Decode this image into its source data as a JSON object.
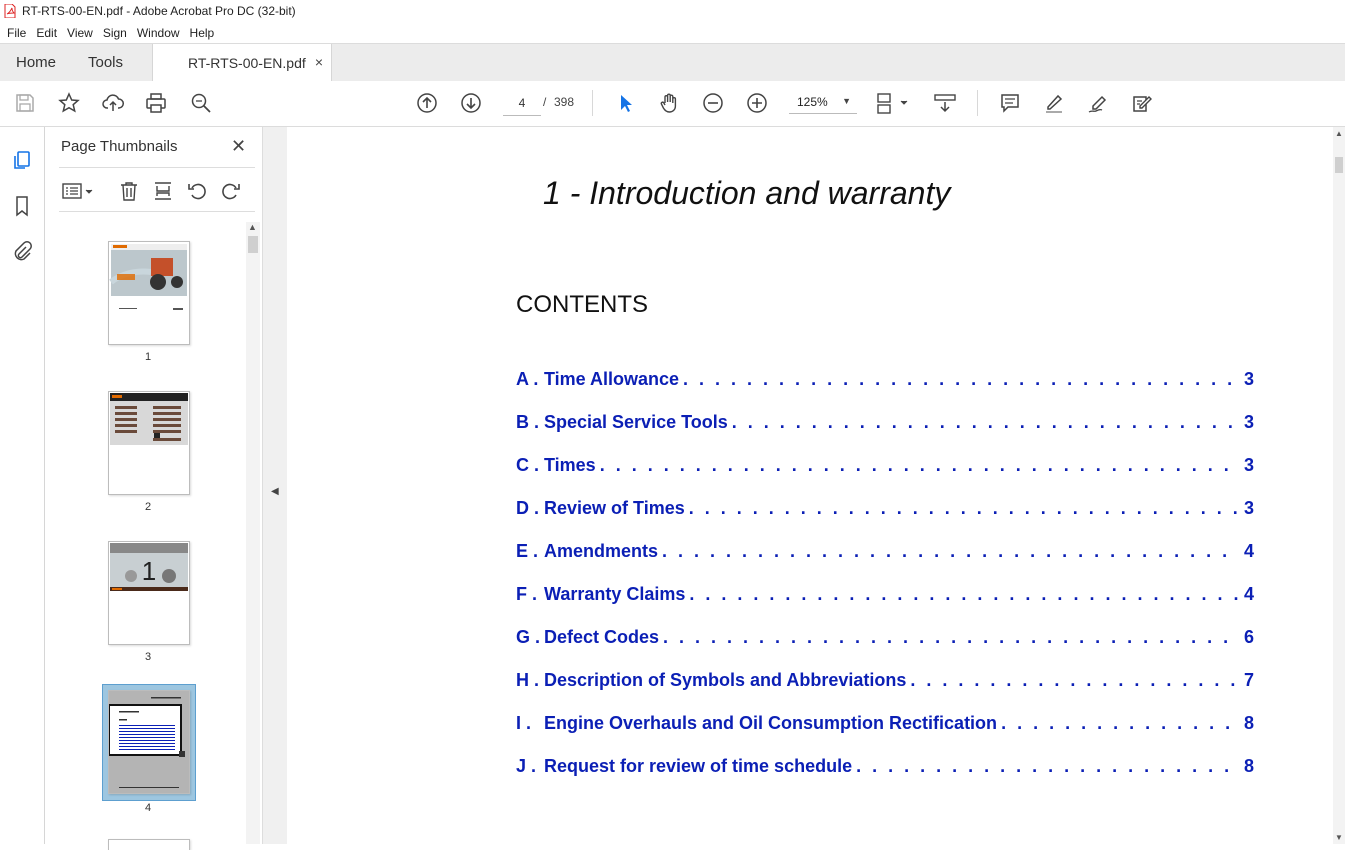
{
  "window": {
    "title": "RT-RTS-00-EN.pdf - Adobe Acrobat Pro DC (32-bit)"
  },
  "menu": [
    "File",
    "Edit",
    "View",
    "Sign",
    "Window",
    "Help"
  ],
  "tabs": {
    "home": "Home",
    "tools": "Tools",
    "document": "RT-RTS-00-EN.pdf",
    "close_glyph": "×"
  },
  "toolbar": {
    "current_page": "4",
    "page_separator": "/",
    "total_pages": "398",
    "zoom": "125%",
    "icons": [
      "save-icon",
      "bookmark-star-icon",
      "upload-icon",
      "print-icon",
      "search-zoom-icon",
      "prev-page-icon",
      "next-page-icon",
      "select-cursor-icon",
      "hand-icon",
      "zoom-out-icon",
      "zoom-in-icon",
      "page-display-icon",
      "scroll-icon",
      "comment-icon",
      "highlight-icon",
      "sign-icon",
      "edit-icon"
    ]
  },
  "panel": {
    "title": "Page Thumbnails",
    "close_glyph": "✕",
    "thumbnails": [
      {
        "number": "1"
      },
      {
        "number": "2"
      },
      {
        "number": "3",
        "label": "1"
      },
      {
        "number": "4",
        "selected": true
      }
    ]
  },
  "document": {
    "chapter_title": "1 - Introduction and warranty",
    "contents_heading": "CONTENTS",
    "link_color": "#0b1fb5",
    "toc": [
      {
        "letter": "A .",
        "title": "Time Allowance",
        "page": "3"
      },
      {
        "letter": "B .",
        "title": "Special Service Tools",
        "page": "3"
      },
      {
        "letter": "C .",
        "title": "Times",
        "page": "3"
      },
      {
        "letter": "D .",
        "title": "Review of Times",
        "page": "3"
      },
      {
        "letter": "E .",
        "title": "Amendments",
        "page": "4"
      },
      {
        "letter": "F .",
        "title": "Warranty Claims",
        "page": "4"
      },
      {
        "letter": "G .",
        "title": "Defect Codes",
        "page": "6"
      },
      {
        "letter": "H .",
        "title": "Description of Symbols and Abbreviations",
        "page": "7"
      },
      {
        "letter": "I .",
        "title": "Engine Overhauls and Oil Consumption Rectification",
        "page": "8"
      },
      {
        "letter": "J .",
        "title": "Request for review of time schedule",
        "page": "8"
      }
    ]
  }
}
